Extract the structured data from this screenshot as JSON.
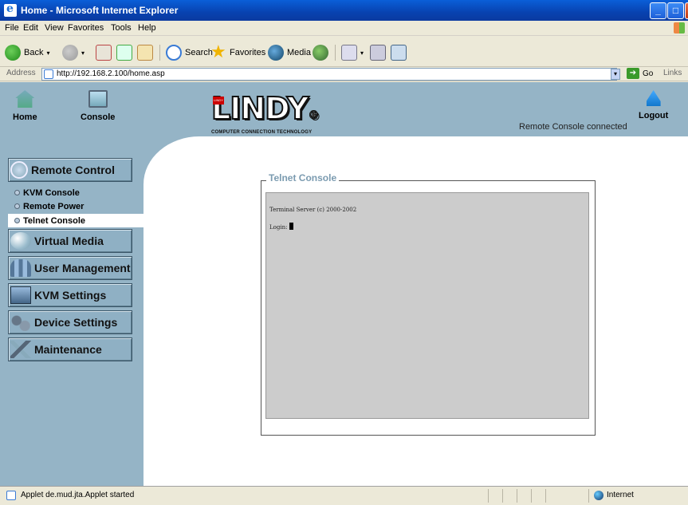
{
  "window": {
    "title": "Home - Microsoft Internet Explorer",
    "min_label": "_",
    "max_label": "□",
    "close_label": "X"
  },
  "menubar": [
    "File",
    "Edit",
    "View",
    "Favorites",
    "Tools",
    "Help"
  ],
  "toolbar": {
    "back": "Back",
    "search": "Search",
    "favorites": "Favorites",
    "media": "Media",
    "dropdown_arrow": "▾"
  },
  "address": {
    "label": "Address",
    "url": "http://192.168.2.100/home.asp",
    "go": "Go",
    "links": "Links"
  },
  "header": {
    "home": "Home",
    "console": "Console",
    "logo_text": "LINDY",
    "logo_registered": "®",
    "logo_tagline": "COMPUTER CONNECTION TECHNOLOGY",
    "logo_badge": "LINDY",
    "status": "Remote Console connected",
    "logout": "Logout"
  },
  "sidebar": {
    "remote_control": "Remote Control",
    "sub": [
      "KVM Console",
      "Remote Power",
      "Telnet Console"
    ],
    "virtual_media": "Virtual Media",
    "user_management": "User Management",
    "kvm_settings": "KVM Settings",
    "device_settings": "Device Settings",
    "maintenance": "Maintenance"
  },
  "telnet": {
    "legend": "Telnet Console",
    "line1": "Terminal Server (c) 2000-2002",
    "login": "Login:"
  },
  "statusbar": {
    "text": "Applet de.mud.jta.Applet started",
    "zone": "Internet"
  },
  "colors": {
    "header_band": "#95b4c6",
    "terminal_bg": "#cccccc",
    "legend_color": "#7b9bb0"
  }
}
